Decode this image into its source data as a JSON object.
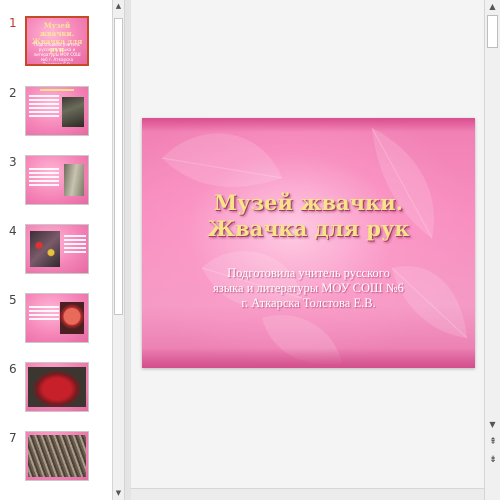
{
  "thumbnails": [
    {
      "number": "1",
      "title": "Музей жвачки. Жвачка для рук",
      "subtitle": "Подготовила учитель русского языка и литературы МОУ СОШ №6 г. Аткарска Толстова Е.В."
    },
    {
      "number": "2"
    },
    {
      "number": "3"
    },
    {
      "number": "4"
    },
    {
      "number": "5"
    },
    {
      "number": "6"
    },
    {
      "number": "7"
    }
  ],
  "slide": {
    "title_line1": "Музей жвачки.",
    "title_line2": "Жвачка для рук",
    "subtitle_line1": "Подготовила учитель русского",
    "subtitle_line2": "языка и литературы МОУ СОШ №6",
    "subtitle_line3": "г. Аткарска Толстова Е.В."
  },
  "colors": {
    "slide_pink": "#f07fb3",
    "title_gold": "#f6e38a",
    "active_border": "#c74a28"
  },
  "icons": {
    "scroll_up": "triangle-up",
    "scroll_down": "triangle-down",
    "prev_slide": "double-chevron-up",
    "next_slide": "double-chevron-down"
  }
}
